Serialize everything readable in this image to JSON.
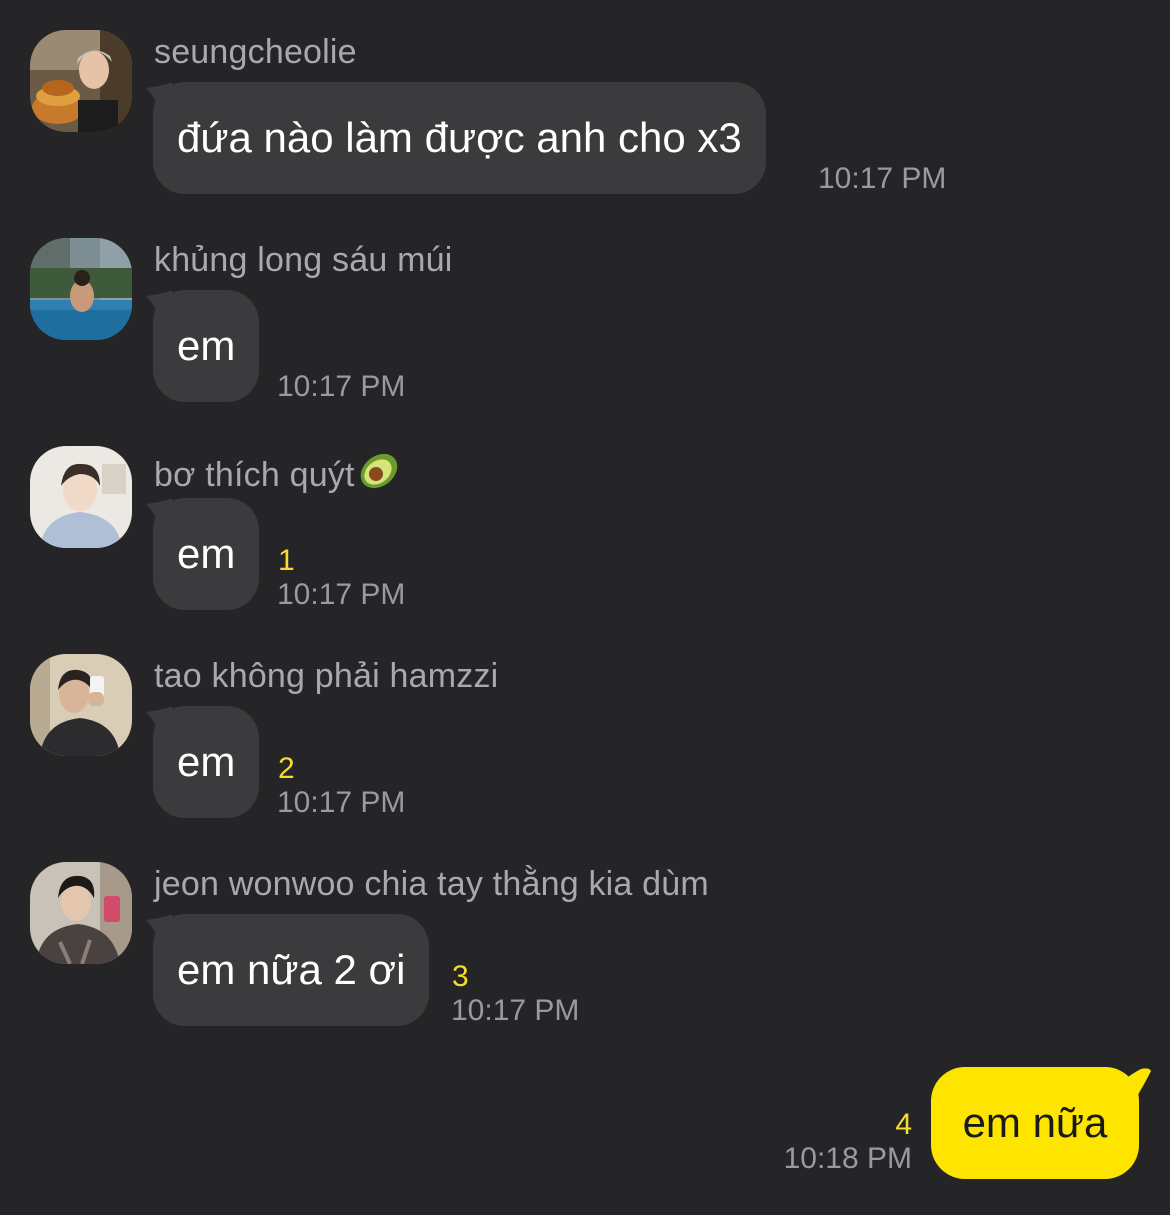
{
  "colors": {
    "background": "#252527",
    "incoming_bubble": "#3b3b3d",
    "outgoing_bubble": "#fee500",
    "name_text": "#a9a9ad",
    "time_text": "#9a9a9e",
    "unread_count": "#f5dd2c"
  },
  "messages": [
    {
      "sender": "seungcheolie",
      "text": "đứa nào làm được anh cho x3",
      "time": "10:17 PM",
      "unread": ""
    },
    {
      "sender": "khủng long sáu múi",
      "text": "em",
      "time": "10:17 PM",
      "unread": ""
    },
    {
      "sender": "bơ thích quýt",
      "sender_emoji": "avocado-emoji",
      "text": "em",
      "time": "10:17 PM",
      "unread": "1"
    },
    {
      "sender": "tao không phải hamzzi",
      "text": "em",
      "time": "10:17 PM",
      "unread": "2"
    },
    {
      "sender": "jeon wonwoo chia tay thằng kia dùm",
      "text": "em nữa 2 ơi",
      "time": "10:17 PM",
      "unread": "3"
    }
  ],
  "my_message": {
    "text": "em nữa",
    "time": "10:18 PM",
    "unread": "4"
  }
}
